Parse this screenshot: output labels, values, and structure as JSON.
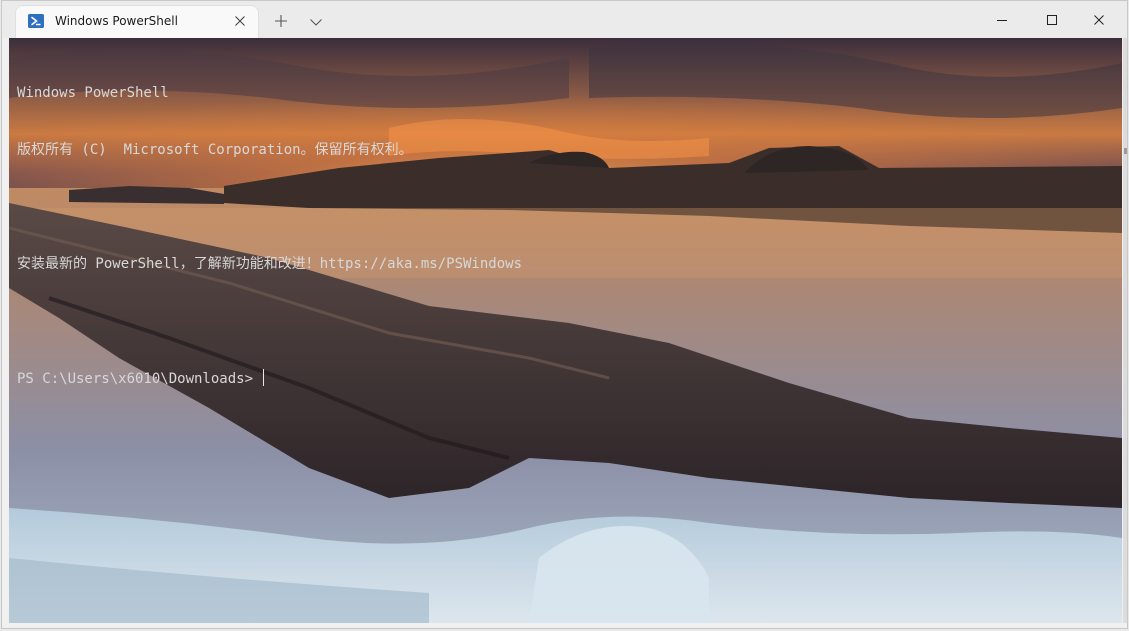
{
  "window": {
    "tab_title": "Windows PowerShell"
  },
  "console": {
    "lines": [
      "Windows PowerShell",
      "版权所有 (C)  Microsoft Corporation。保留所有权利。",
      "",
      "安装最新的 PowerShell，了解新功能和改进！https://aka.ms/PSWindows",
      "",
      "PS C:\\Users\\x6010\\Downloads> "
    ]
  },
  "colors": {
    "titlebar": "#ebebeb",
    "tab": "#f9f9f9",
    "console_text": "#d8d8d8",
    "powershell_icon": "#2f6fc0"
  },
  "icons": {
    "tab": "powershell-icon",
    "tab_close": "close-icon",
    "new_tab": "plus-icon",
    "dropdown": "chevron-down-icon",
    "minimize": "minimize-icon",
    "maximize": "maximize-icon",
    "close": "close-icon"
  },
  "background": "sunset-rocky-shore-wallpaper"
}
